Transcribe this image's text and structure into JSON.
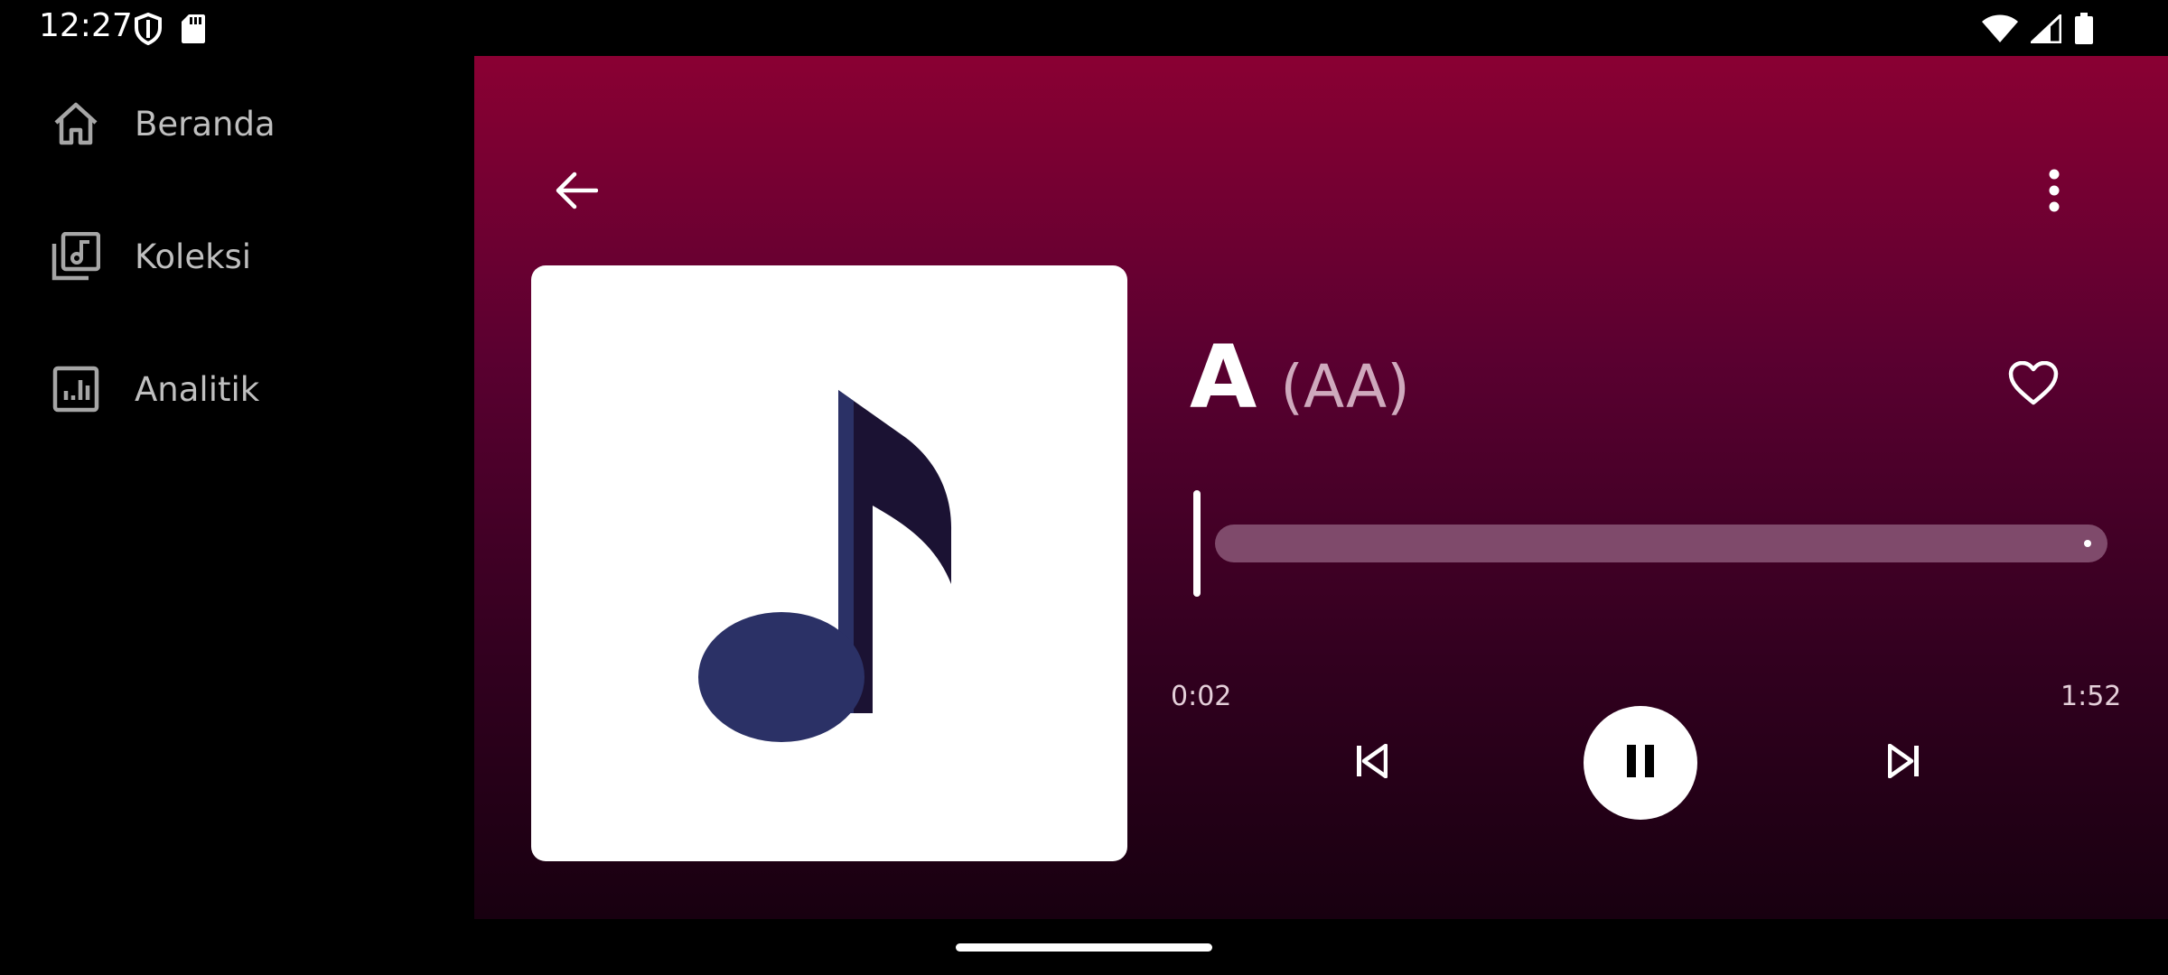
{
  "status_bar": {
    "time": "12:27",
    "left_icons": [
      "shield-icon",
      "sd-card-icon"
    ],
    "right_icons": [
      "wifi-icon",
      "signal-icon",
      "battery-icon"
    ]
  },
  "sidebar": {
    "items": [
      {
        "label": "Beranda",
        "icon": "home-icon"
      },
      {
        "label": "Koleksi",
        "icon": "library-music-icon"
      },
      {
        "label": "Analitik",
        "icon": "analytics-icon"
      }
    ]
  },
  "player": {
    "track_title": "A",
    "track_artist": "(AA)",
    "elapsed_time": "0:02",
    "total_time": "1:52",
    "progress_fraction": 0.018,
    "state": "playing",
    "favorite": false,
    "colors": {
      "gradient_top": "#8a0033",
      "gradient_bottom": "#180010",
      "note_color": "#2b3166"
    }
  }
}
